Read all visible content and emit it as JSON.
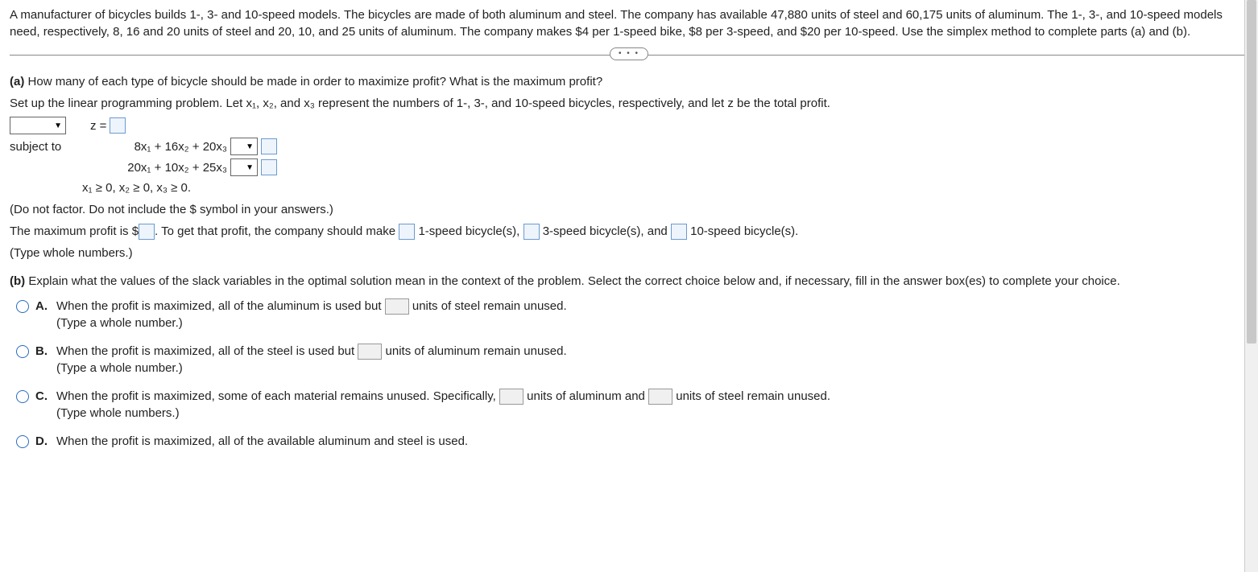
{
  "problem": {
    "intro": "A manufacturer of bicycles builds 1-, 3- and 10-speed models. The bicycles are made of both aluminum and steel. The company has available 47,880 units of steel and 60,175 units of aluminum. The 1-, 3-, and 10-speed models need, respectively, 8, 16 and 20 units of steel and 20, 10, and 25 units of aluminum. The company makes $4 per 1-speed bike, $8 per 3-speed, and $20 per 10-speed. Use the simplex method to complete parts (a) and (b)."
  },
  "ellipsis": "• • •",
  "partA": {
    "label": "(a)",
    "question": "How many of each type of bicycle should be made in order to maximize profit? What is the maximum profit?",
    "setup": "Set up the linear programming problem. Let x₁, x₂, and x₃ represent the numbers of 1-, 3-, and 10-speed bicycles, respectively, and let z be the total profit.",
    "z_eq": "z =",
    "subject_to": "subject to",
    "c1": "8x₁ + 16x₂ + 20x₃",
    "c2": "20x₁ + 10x₂ + 25x₃",
    "nonneg": "x₁ ≥ 0, x₂ ≥ 0, x₃ ≥ 0.",
    "note": "(Do not factor. Do not include the $ symbol in your answers.)",
    "profit_pre": "The maximum profit is $",
    "profit_mid": ". To get that profit, the company should make",
    "s1": "1-speed bicycle(s),",
    "s3": "3-speed bicycle(s), and",
    "s10": "10-speed bicycle(s).",
    "hint": "(Type whole numbers.)"
  },
  "partB": {
    "label": "(b)",
    "question": "Explain what the values of the slack variables in the optimal solution mean in the context of the problem. Select the correct choice below and, if necessary, fill in the answer box(es) to complete your choice.",
    "choices": {
      "A": {
        "letter": "A.",
        "t1": "When the profit is maximized, all of the aluminum is used but",
        "t2": "units of steel remain unused.",
        "hint": "(Type a whole number.)"
      },
      "B": {
        "letter": "B.",
        "t1": "When the profit is maximized, all of the steel is used but",
        "t2": "units of aluminum remain unused.",
        "hint": "(Type a whole number.)"
      },
      "C": {
        "letter": "C.",
        "t1": "When the profit is maximized, some of each material remains unused. Specifically,",
        "t2": "units of aluminum and",
        "t3": "units of steel remain unused.",
        "hint": "(Type whole numbers.)"
      },
      "D": {
        "letter": "D.",
        "text": "When the profit is maximized, all of the available aluminum and steel is used."
      }
    }
  }
}
